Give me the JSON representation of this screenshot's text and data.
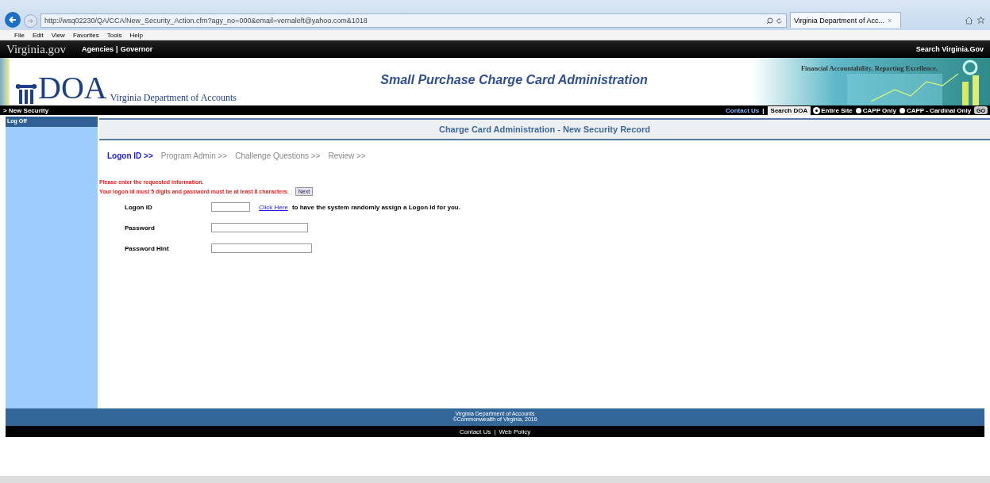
{
  "browser": {
    "url": "http://wsq02230/QA/CCA/New_Security_Action.cfm?agy_no=000&email=vernaleft@yahoo.com&1018",
    "tab_title": "Virginia Department of Acc...",
    "tab_close": "×",
    "menu": [
      "File",
      "Edit",
      "View",
      "Favorites",
      "Tools",
      "Help"
    ]
  },
  "gov_bar": {
    "logo": "Virginia.gov",
    "links": [
      "Agencies",
      "Governor"
    ],
    "separator": "|",
    "search": "Search Virginia.Gov"
  },
  "header": {
    "logo": "DOA",
    "agency": "Virginia Department of Accounts",
    "title": "Small Purchase Charge Card Administration",
    "tagline": "Financial Accountability. Reporting Excellence."
  },
  "nav_bar": {
    "breadcrumb": "> New Security",
    "contact": "Contact Us",
    "separator": "|",
    "search_button": "Search DOA",
    "scopes": [
      {
        "label": "Entire Site",
        "selected": true
      },
      {
        "label": "CAPP Only",
        "selected": false
      },
      {
        "label": "CAPP - Cardinal Only",
        "selected": false
      }
    ],
    "go": "GO"
  },
  "sidebar": {
    "items": [
      "Log Off"
    ]
  },
  "page_title": "Charge Card Administration - New Security Record",
  "steps": [
    {
      "label": "Logon ID >>",
      "selected": true
    },
    {
      "label": "Program Admin >>",
      "selected": false
    },
    {
      "label": "Challenge Questions >>",
      "selected": false
    },
    {
      "label": "Review >>",
      "selected": false
    }
  ],
  "messages": [
    "Please enter the requested information.",
    "Your logon id must 5 digits and password must be at least 8 characters."
  ],
  "next_button": "Next",
  "fields": [
    {
      "label": "Logon ID",
      "link": "Click Here",
      "note": "to have the system randomly assign a Logon Id for you."
    },
    {
      "label": "Password"
    },
    {
      "label": "Password Hint"
    }
  ],
  "footer": {
    "lines": [
      "Virginia Department of Accounts",
      "©Commonwealth of Virginia, 2016"
    ],
    "links": [
      "Contact Us",
      "Web Policy"
    ],
    "separator": "|"
  }
}
